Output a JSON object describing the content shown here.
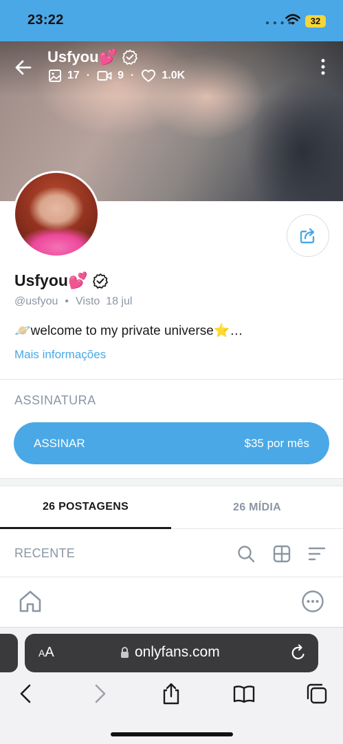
{
  "status_bar": {
    "time": "23:22",
    "battery": "32"
  },
  "cover": {
    "title": "Usfyou💕",
    "stats": {
      "photos": "17",
      "videos": "9",
      "likes": "1.0K"
    }
  },
  "profile": {
    "name": "Usfyou💕",
    "handle": "@usfyou",
    "last_seen": "Visto  18 jul",
    "bio": "🪐welcome to my private universe⭐…",
    "more_info": "Mais informações"
  },
  "subscription": {
    "section_title": "ASSINATURA",
    "button_label": "ASSINAR",
    "price": "$35 por mês"
  },
  "tabs": [
    {
      "label": "26 POSTAGENS",
      "active": true
    },
    {
      "label": "26 MÍDIA",
      "active": false
    }
  ],
  "feed": {
    "sort_label": "RECENTE"
  },
  "browser": {
    "aa_small": "A",
    "aa_large": "A",
    "url": "onlyfans.com"
  },
  "colors": {
    "accent": "#4aa8e6",
    "muted": "#8a96a3",
    "text": "#1a1a1a"
  },
  "icons": [
    "back-icon",
    "verified-icon",
    "image-icon",
    "video-icon",
    "heart-icon",
    "more-icon",
    "share-icon",
    "search-icon",
    "grid-icon",
    "sort-icon",
    "home-icon",
    "chat-icon",
    "lock-icon",
    "reload-icon",
    "browser-back-icon",
    "browser-forward-icon",
    "browser-share-icon",
    "bookmarks-icon",
    "tabs-icon"
  ]
}
